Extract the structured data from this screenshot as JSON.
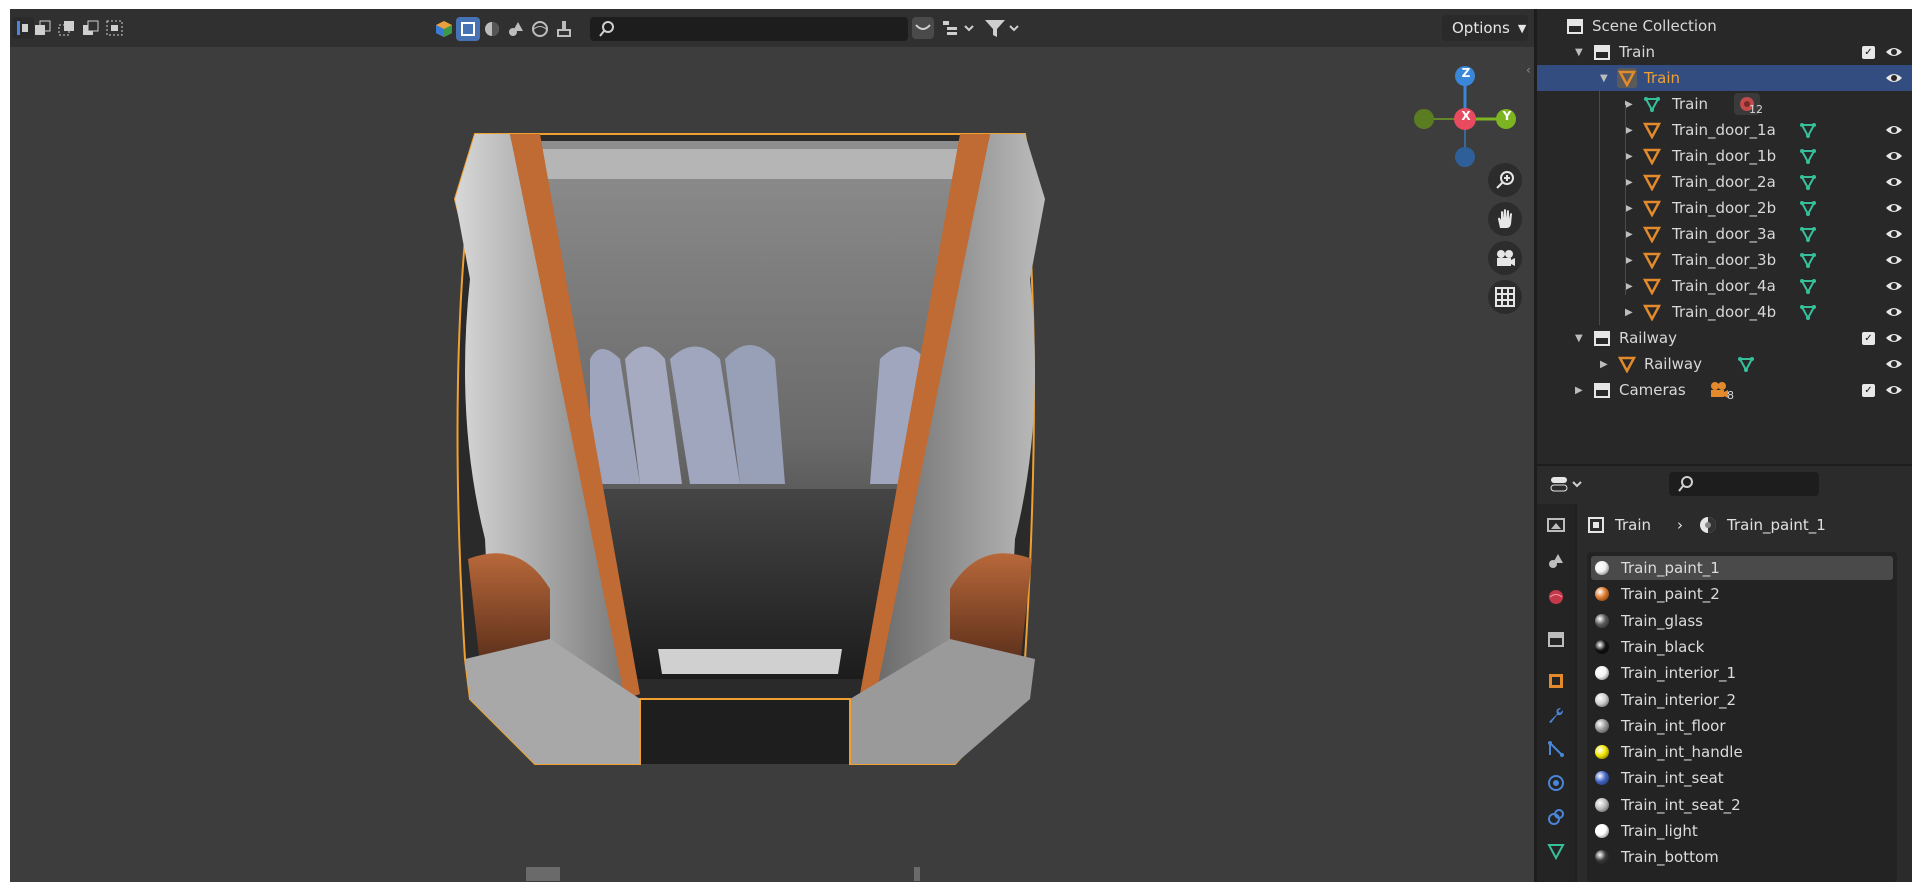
{
  "viewport": {
    "options_label": "Options",
    "search_placeholder": "",
    "gizmo": {
      "z": "Z",
      "x": "X",
      "y": "Y"
    }
  },
  "outliner": {
    "root": "Scene Collection",
    "rows": [
      {
        "label": "Train",
        "kind": "collection",
        "checked": true
      },
      {
        "label": "Train",
        "kind": "mesh-object",
        "selected": true
      },
      {
        "label": "Train",
        "kind": "mesh-data",
        "badge": "12"
      },
      {
        "label": "Train_door_1a",
        "kind": "mesh-object"
      },
      {
        "label": "Train_door_1b",
        "kind": "mesh-object"
      },
      {
        "label": "Train_door_2a",
        "kind": "mesh-object"
      },
      {
        "label": "Train_door_2b",
        "kind": "mesh-object"
      },
      {
        "label": "Train_door_3a",
        "kind": "mesh-object"
      },
      {
        "label": "Train_door_3b",
        "kind": "mesh-object"
      },
      {
        "label": "Train_door_4a",
        "kind": "mesh-object"
      },
      {
        "label": "Train_door_4b",
        "kind": "mesh-object"
      },
      {
        "label": "Railway",
        "kind": "collection",
        "checked": true
      },
      {
        "label": "Railway",
        "kind": "mesh-object"
      },
      {
        "label": "Cameras",
        "kind": "collection",
        "checked": true,
        "badge": "8"
      }
    ]
  },
  "properties": {
    "breadcrumb": {
      "object": "Train",
      "material": "Train_paint_1"
    },
    "materials": [
      {
        "name": "Train_paint_1",
        "color": "#f2f2f2",
        "selected": true
      },
      {
        "name": "Train_paint_2",
        "color": "#e07a2e"
      },
      {
        "name": "Train_glass",
        "color": "#5a5a5a"
      },
      {
        "name": "Train_black",
        "color": "#111111"
      },
      {
        "name": "Train_interior_1",
        "color": "#f5f5f5"
      },
      {
        "name": "Train_interior_2",
        "color": "#cfcfcf"
      },
      {
        "name": "Train_int_floor",
        "color": "#9a9a9a"
      },
      {
        "name": "Train_int_handle",
        "color": "#f2e600"
      },
      {
        "name": "Train_int_seat",
        "color": "#4466c8"
      },
      {
        "name": "Train_int_seat_2",
        "color": "#bdbdbd"
      },
      {
        "name": "Train_light",
        "color": "#ffffff"
      },
      {
        "name": "Train_bottom",
        "color": "#3a3a3a"
      }
    ]
  },
  "colors": {
    "selection": "#334d80",
    "object_orange": "#e38a2d",
    "mesh_green": "#36c09a",
    "axis_x": "#e84a5f",
    "axis_y": "#7cb521",
    "axis_z": "#3a86d8"
  }
}
